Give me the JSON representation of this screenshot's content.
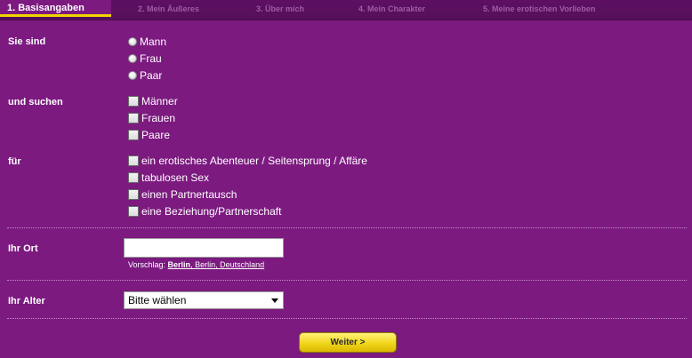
{
  "steps": [
    {
      "label": "1. Basisangaben",
      "active": true
    },
    {
      "label": "2. Mein Äußeres",
      "active": false
    },
    {
      "label": "3. Über mich",
      "active": false
    },
    {
      "label": "4. Mein Charakter",
      "active": false
    },
    {
      "label": "5. Meine erotischen Vorlieben",
      "active": false
    }
  ],
  "sie_sind": {
    "label": "Sie sind",
    "options": [
      "Mann",
      "Frau",
      "Paar"
    ]
  },
  "und_suchen": {
    "label": "und suchen",
    "options": [
      "Männer",
      "Frauen",
      "Paare"
    ]
  },
  "fuer": {
    "label": "für",
    "options": [
      "ein erotisches Abenteuer / Seitensprung / Affäre",
      "tabulosen Sex",
      "einen Partnertausch",
      "eine Beziehung/Partnerschaft"
    ]
  },
  "ort": {
    "label": "Ihr Ort",
    "value": "",
    "suggestion_prefix": "Vorschlag:",
    "suggestion_city": "Berlin",
    "suggestion_rest": ", Berlin, Deutschland"
  },
  "alter": {
    "label": "Ihr Alter",
    "selected": "Bitte wählen"
  },
  "submit": {
    "label": "Weiter >"
  },
  "colors": {
    "background": "#7c1a80",
    "accent": "#f0d500"
  }
}
